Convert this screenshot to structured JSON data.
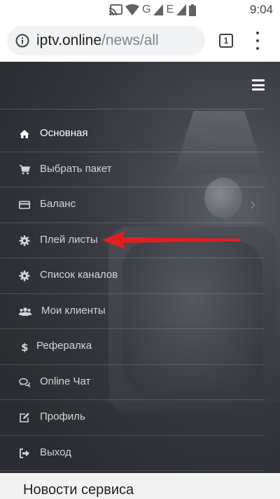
{
  "status_bar": {
    "network_letters": [
      "G",
      "E"
    ],
    "time": "9:04",
    "icons": [
      "cast-icon",
      "wifi-icon",
      "signal-icon",
      "signal-icon",
      "battery-icon"
    ]
  },
  "browser": {
    "url_domain": "iptv.online",
    "url_path": "/news/all",
    "tab_count": "1"
  },
  "menu": {
    "items": [
      {
        "label": "Основная",
        "icon": "home-icon"
      },
      {
        "label": "Выбрать пакет",
        "icon": "cart-icon"
      },
      {
        "label": "Баланс",
        "icon": "card-icon"
      },
      {
        "label": "Плей листы",
        "icon": "gear-icon"
      },
      {
        "label": "Список каналов",
        "icon": "gear-icon"
      },
      {
        "label": "Мои клиенты",
        "icon": "users-icon"
      },
      {
        "label": "Рефералка",
        "icon": "dollar-icon"
      },
      {
        "label": "Online Чат",
        "icon": "chat-icon"
      },
      {
        "label": "Профиль",
        "icon": "edit-icon"
      },
      {
        "label": "Выход",
        "icon": "logout-icon"
      }
    ]
  },
  "news": {
    "title": "Новости сервиса"
  },
  "colors": {
    "menu_background": "#2a2d33",
    "annotation_arrow": "#e02020",
    "menu_text": "#d3d5d9"
  }
}
